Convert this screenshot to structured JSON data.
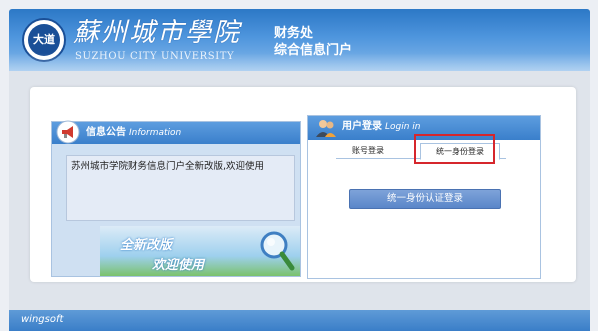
{
  "header": {
    "logo_seal_text": "大道",
    "school_name_cn": "蘇州城市學院",
    "school_name_en": "SUZHOU CITY UNIVERSITY",
    "department": "财务处",
    "portal_title": "综合信息门户"
  },
  "announcement": {
    "title": "信息公告",
    "title_en": "Information",
    "notice_text": "苏州城市学院财务信息门户全新改版,欢迎使用",
    "banner_line1": "全新改版",
    "banner_line2": "欢迎使用"
  },
  "login": {
    "title": "用户登录",
    "title_en": "Login in",
    "tabs": [
      {
        "label": "账号登录"
      },
      {
        "label": "统一身份登录"
      }
    ],
    "sso_button": "统一身份认证登录"
  },
  "footer": {
    "brand": "wingsoft"
  },
  "colors": {
    "header_blue": "#2c78c6",
    "panel_header_blue": "#3a7fcb",
    "highlight_red": "#d6262c",
    "button_blue": "#5a86c9"
  },
  "icons": {
    "announcement": "megaphone-icon",
    "login": "users-icon",
    "banner": "magnifier-icon"
  }
}
